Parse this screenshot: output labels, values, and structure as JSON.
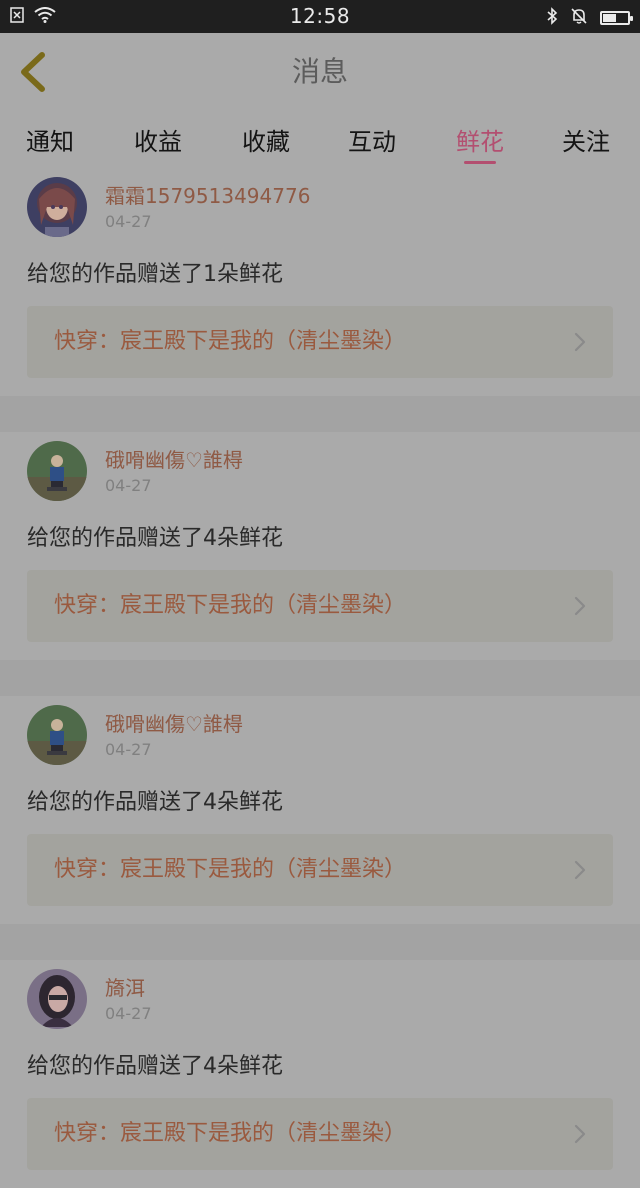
{
  "status_bar": {
    "time": "12:58",
    "icons": [
      "notification-x-icon",
      "wifi-icon",
      "bluetooth-icon",
      "mute-bell-icon",
      "battery-icon"
    ],
    "battery_level": 0.55
  },
  "header": {
    "back_icon": "chevron-left-icon",
    "title": "消息"
  },
  "tabs": [
    {
      "label": "通知",
      "active": false
    },
    {
      "label": "收益",
      "active": false
    },
    {
      "label": "收藏",
      "active": false
    },
    {
      "label": "互动",
      "active": false
    },
    {
      "label": "鲜花",
      "active": true
    },
    {
      "label": "关注",
      "active": false
    }
  ],
  "notifications": [
    {
      "username": "霜霜1579513494776",
      "date": "04-27",
      "message": "给您的作品赠送了1朵鲜花",
      "work_title": "快穿：宸王殿下是我的（清尘墨染）"
    },
    {
      "username": "硪嗗幽傷♡誰棏",
      "date": "04-27",
      "message": "给您的作品赠送了4朵鲜花",
      "work_title": "快穿：宸王殿下是我的（清尘墨染）"
    },
    {
      "username": "硪嗗幽傷♡誰棏",
      "date": "04-27",
      "message": "给您的作品赠送了4朵鲜花",
      "work_title": "快穿：宸王殿下是我的（清尘墨染）"
    },
    {
      "username": "旖洱",
      "date": "04-27",
      "message": "给您的作品赠送了4朵鲜花",
      "work_title": "快穿：宸王殿下是我的（清尘墨染）"
    }
  ],
  "colors": {
    "accent": "#b34f70",
    "username": "#8f5a45",
    "work_title": "#9a5a3f",
    "back_arrow": "#7a6a1a"
  }
}
